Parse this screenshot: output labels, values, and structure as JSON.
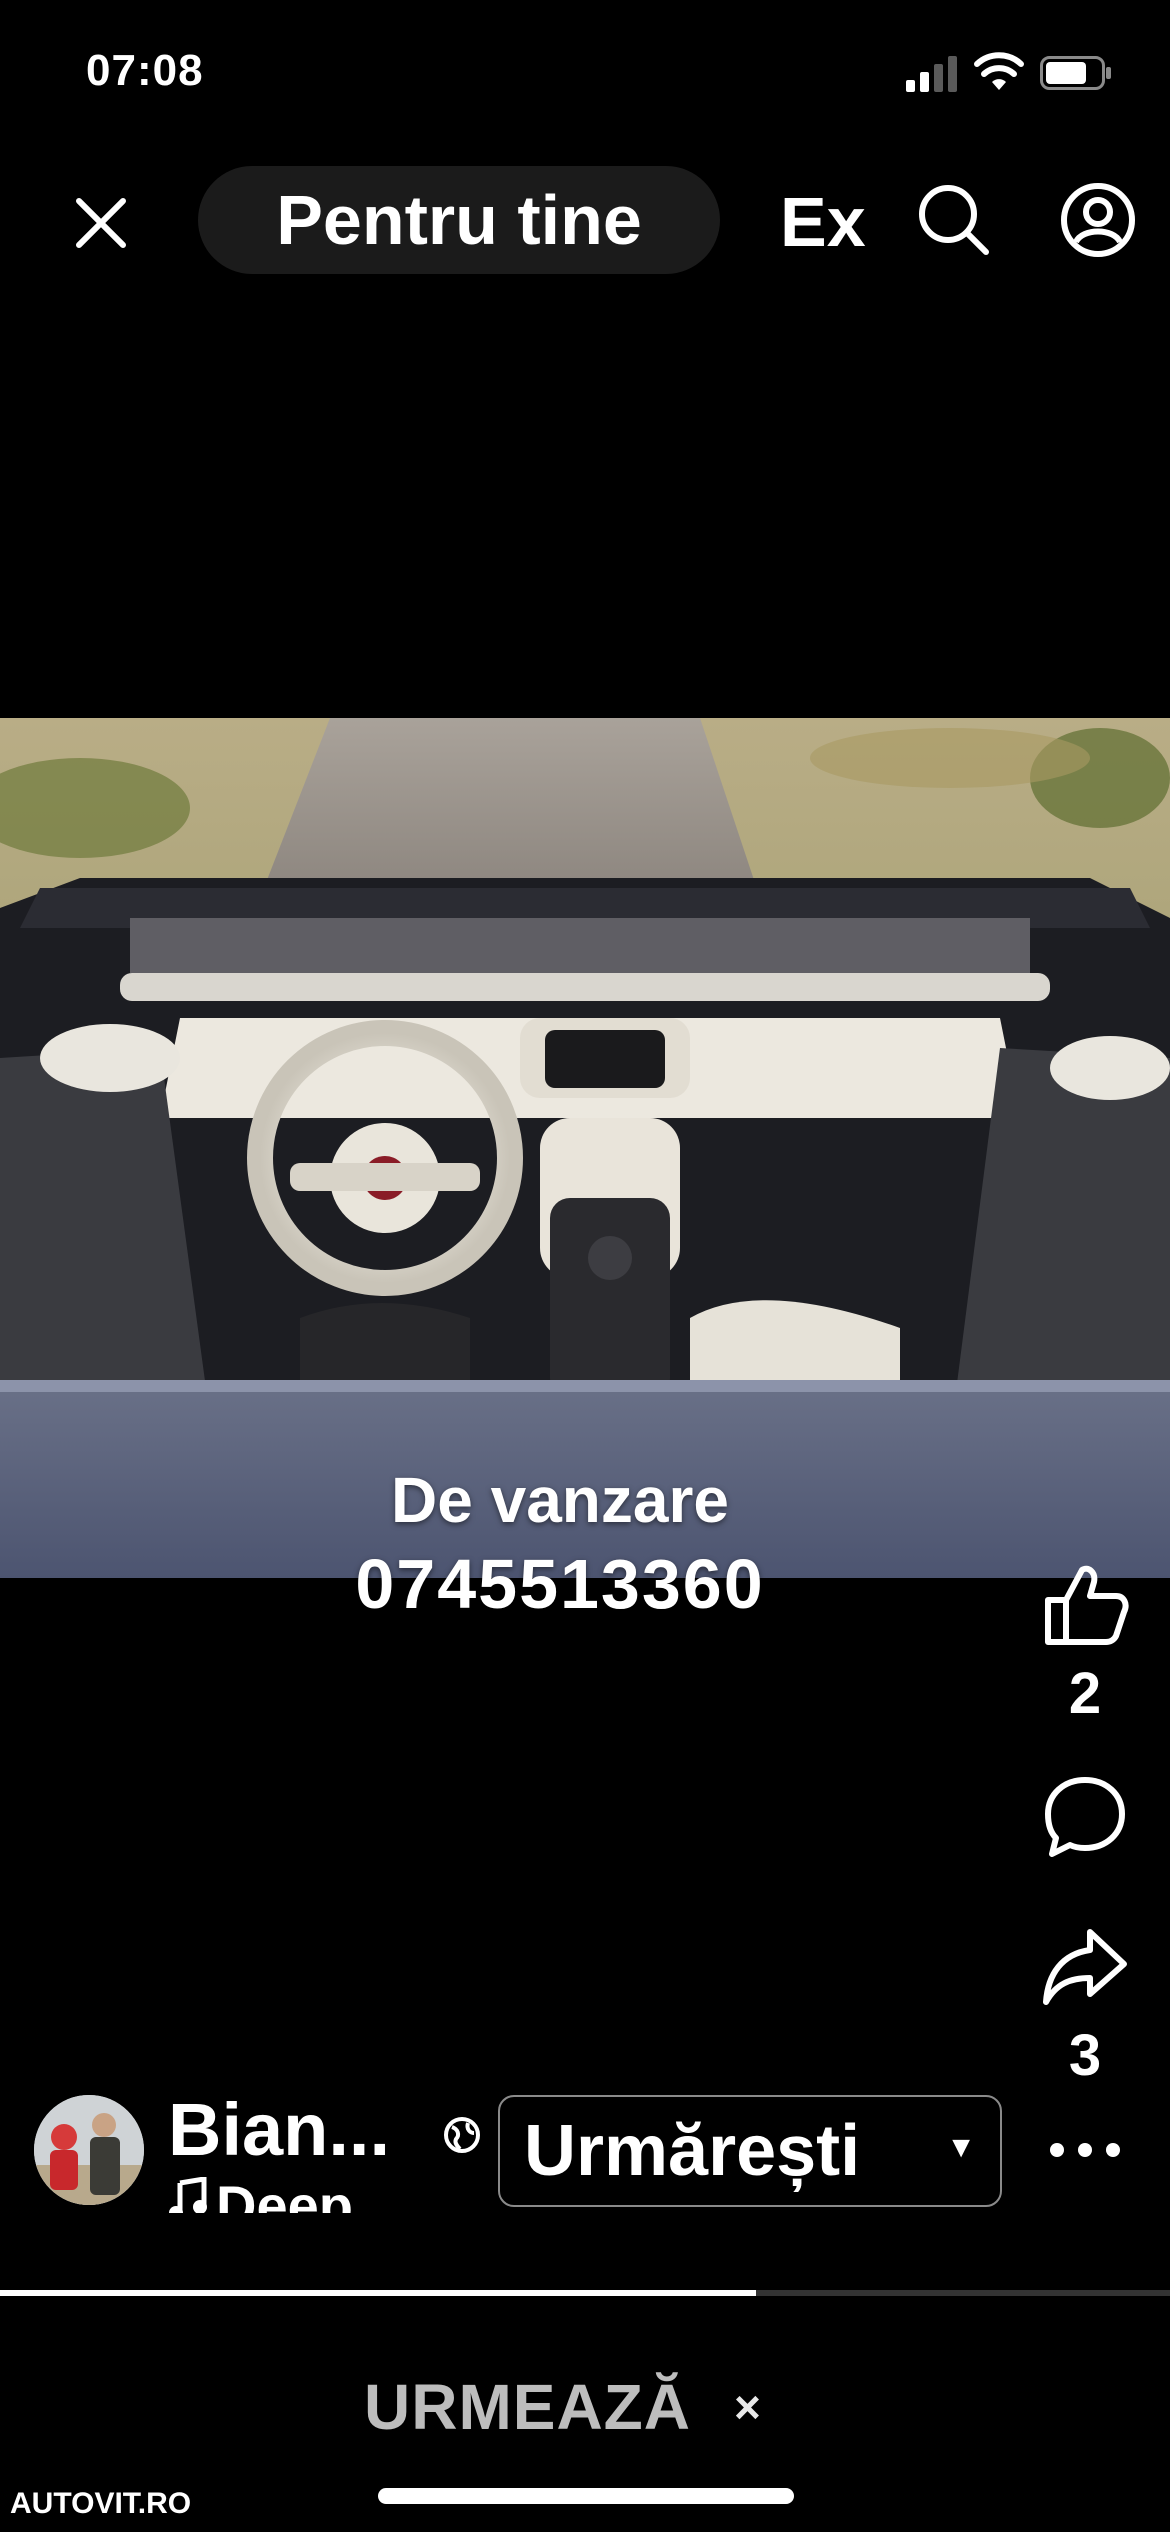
{
  "status_bar": {
    "time": "07:08",
    "signal_icon": "cellular-signal-icon",
    "wifi_icon": "wifi-icon",
    "battery_icon": "battery-icon"
  },
  "top_nav": {
    "close_icon": "close-icon",
    "active_tab": "Pentru tine",
    "next_tab": "Ex",
    "search_icon": "search-icon",
    "profile_icon": "profile-icon"
  },
  "video": {
    "overlay_line1": "De vanzare",
    "overlay_line2": "0745513360"
  },
  "actions": {
    "like_icon": "thumbs-up-icon",
    "like_count": "2",
    "comment_icon": "comment-icon",
    "share_icon": "share-arrow-icon",
    "share_count": "3"
  },
  "author": {
    "name": "Bian...",
    "sound": "Deep...",
    "sound_icon": "music-note-icon",
    "globe_icon": "globe-icon",
    "follow_label": "Urmărești",
    "more_icon": "more-dots-icon"
  },
  "playback": {
    "progress": 0.646
  },
  "next_bar": {
    "label": "URMEAZĂ",
    "close": "×"
  },
  "watermark": "AUTOVIT.RO",
  "colors": {
    "background": "#000000",
    "text": "#ffffff",
    "tab_pill": "#1b1b1b",
    "next_label": "#bdbdbd"
  }
}
